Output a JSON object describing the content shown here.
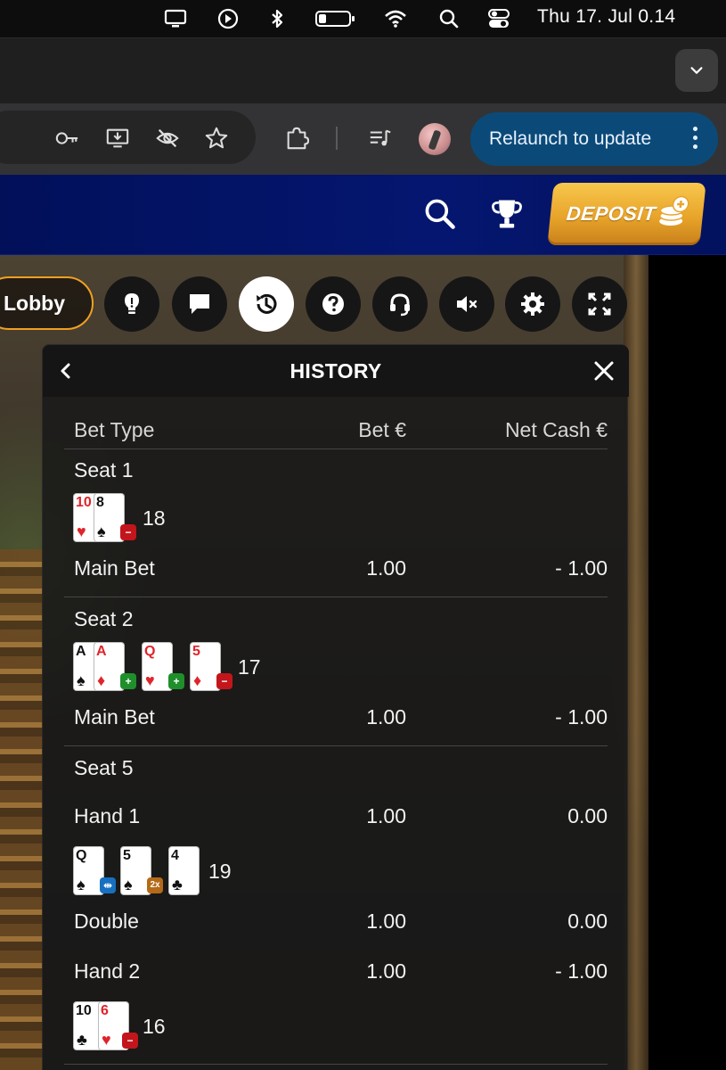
{
  "menubar": {
    "clock": "Thu 17. Jul  0.14",
    "icons": [
      "display-icon",
      "play-circle-icon",
      "bluetooth-icon",
      "battery-icon",
      "wifi-icon",
      "search-icon",
      "control-center-icon"
    ]
  },
  "browser": {
    "toolbar_icons": [
      "key-icon",
      "install-app-icon",
      "eye-off-icon",
      "star-icon",
      "extensions-icon",
      "media-queue-icon"
    ],
    "relaunch_label": "Relaunch to update"
  },
  "site_header": {
    "deposit_label": "DEPOSIT",
    "icons": [
      "search-icon",
      "trophy-icon"
    ]
  },
  "game_controls": {
    "lobby_label": "Lobby",
    "buttons": [
      "lightbulb-icon",
      "chat-icon",
      "history-icon",
      "help-icon",
      "support-headset-icon",
      "mute-icon",
      "settings-icon",
      "fullscreen-icon"
    ]
  },
  "history": {
    "title": "HISTORY",
    "columns": {
      "bet_type": "Bet Type",
      "bet": "Bet €",
      "net_cash": "Net Cash €"
    },
    "seat1": {
      "label": "Seat 1",
      "cards": [
        {
          "rank": "10",
          "suit": "♥"
        },
        {
          "rank": "8",
          "suit": "♠"
        }
      ],
      "total": "18",
      "bet_label": "Main Bet",
      "bet": "1.00",
      "net": "- 1.00"
    },
    "seat2": {
      "label": "Seat 2",
      "cards": [
        {
          "rank": "A",
          "suit": "♠"
        },
        {
          "rank": "A",
          "suit": "♦"
        },
        {
          "rank": "Q",
          "suit": "♥"
        },
        {
          "rank": "5",
          "suit": "♦"
        }
      ],
      "total": "17",
      "bet_label": "Main Bet",
      "bet": "1.00",
      "net": "- 1.00"
    },
    "seat5": {
      "label": "Seat 5",
      "hand1": {
        "label": "Hand 1",
        "bet": "1.00",
        "net": "0.00",
        "cards": [
          {
            "rank": "Q",
            "suit": "♠"
          },
          {
            "rank": "5",
            "suit": "♠"
          },
          {
            "rank": "4",
            "suit": "♣"
          }
        ],
        "total": "19",
        "double_label": "Double",
        "double_bet": "1.00",
        "double_net": "0.00"
      },
      "hand2": {
        "label": "Hand 2",
        "bet": "1.00",
        "net": "- 1.00",
        "cards": [
          {
            "rank": "10",
            "suit": "♣"
          },
          {
            "rank": "6",
            "suit": "♥"
          }
        ],
        "total": "16"
      }
    },
    "badges": {
      "minus": "−",
      "plus": "+",
      "split": "⇹",
      "double": "2x"
    }
  },
  "colors": {
    "accent_blue": "#0b4a78",
    "header_blue": "#041670",
    "deposit_gold": "#e8a42a",
    "lobby_orange": "#f0a020",
    "card_red": "#e0242b"
  }
}
